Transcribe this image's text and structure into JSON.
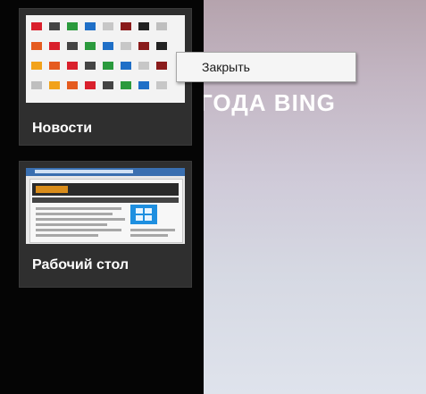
{
  "background": {
    "text": "ГОДА BING"
  },
  "apps": [
    {
      "label": "Новости"
    },
    {
      "label": "Рабочий стол"
    }
  ],
  "context_menu": {
    "close_label": "Закрыть"
  },
  "tile_colors": [
    "#d9202c",
    "#1f6fc7",
    "#222222",
    "#e55b1f",
    "#2b9a3d",
    "#8a1b1b",
    "#f2a21a",
    "#444444",
    "#c7c7c7",
    "#bfbfbf"
  ]
}
